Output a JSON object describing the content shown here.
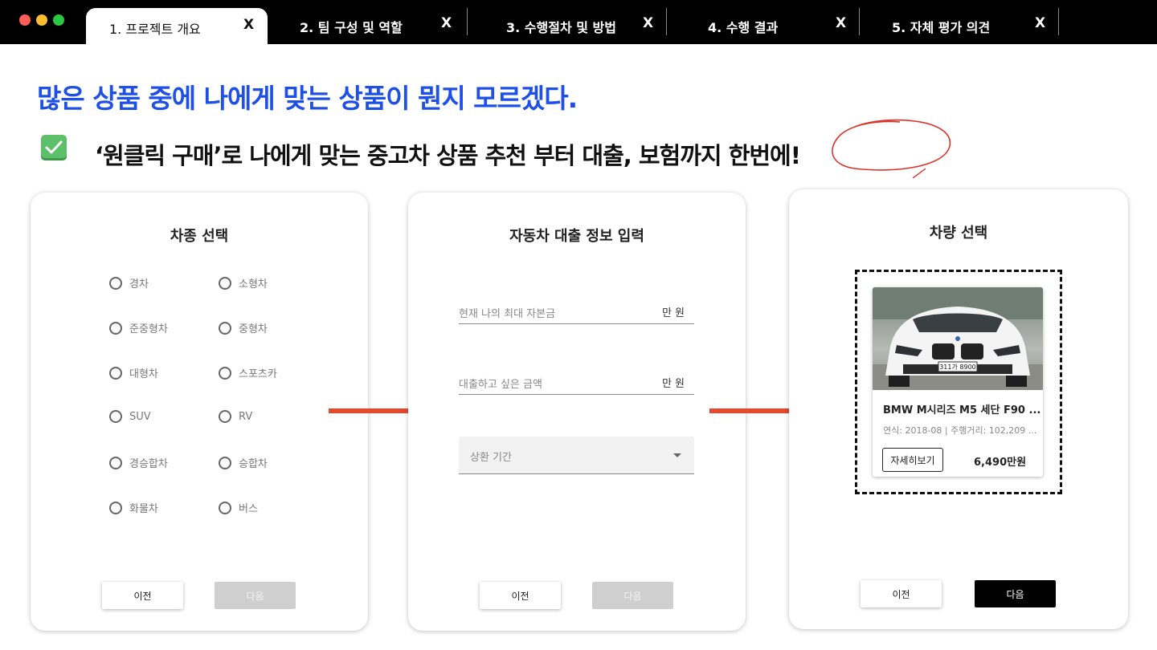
{
  "window": {
    "tabs": [
      {
        "label": "1. 프로젝트 개요",
        "close": "X",
        "active": true
      },
      {
        "label": "2. 팀 구성 및 역할",
        "close": "X",
        "active": false
      },
      {
        "label": "3. 수행절차 및 방법",
        "close": "X",
        "active": false
      },
      {
        "label": "4. 수행 결과",
        "close": "X",
        "active": false
      },
      {
        "label": "5. 자체 평가 의견",
        "close": "X",
        "active": false
      }
    ]
  },
  "headline": "많은 상품 중에 나에게 맞는 상품이 뭔지 모르겠다.",
  "subline": "‘원클릭 구매’로 나에게 맞는 중고차 상품 추천 부터 대출, 보험까지 한번에!",
  "colors": {
    "accent_blue": "#1e4fe6",
    "arrow_red": "#e8472a",
    "check_green": "#5cbf6a"
  },
  "step1": {
    "title": "차종 선택",
    "options": [
      "경차",
      "소형차",
      "준중형차",
      "중형차",
      "대형차",
      "스포츠카",
      "SUV",
      "RV",
      "경승합차",
      "승합차",
      "화물차",
      "버스"
    ],
    "prev": "이전",
    "next": "다음"
  },
  "step2": {
    "title": "자동차 대출 정보 입력",
    "capital_placeholder": "현재 나의 최대 자본금",
    "capital_unit": "만 원",
    "loan_placeholder": "대출하고 싶은 금액",
    "loan_unit": "만 원",
    "term_placeholder": "상환 기간",
    "prev": "이전",
    "next": "다음"
  },
  "step3": {
    "title": "차량 선택",
    "car": {
      "name": "BMW M시리즈 M5 세단 F90 ...",
      "meta": "연식: 2018-08 | 주행거리: 102,209 ...",
      "plate": "311가 8900",
      "detail": "자세히보기",
      "price": "6,490만원"
    },
    "prev": "이전",
    "next": "다음"
  }
}
